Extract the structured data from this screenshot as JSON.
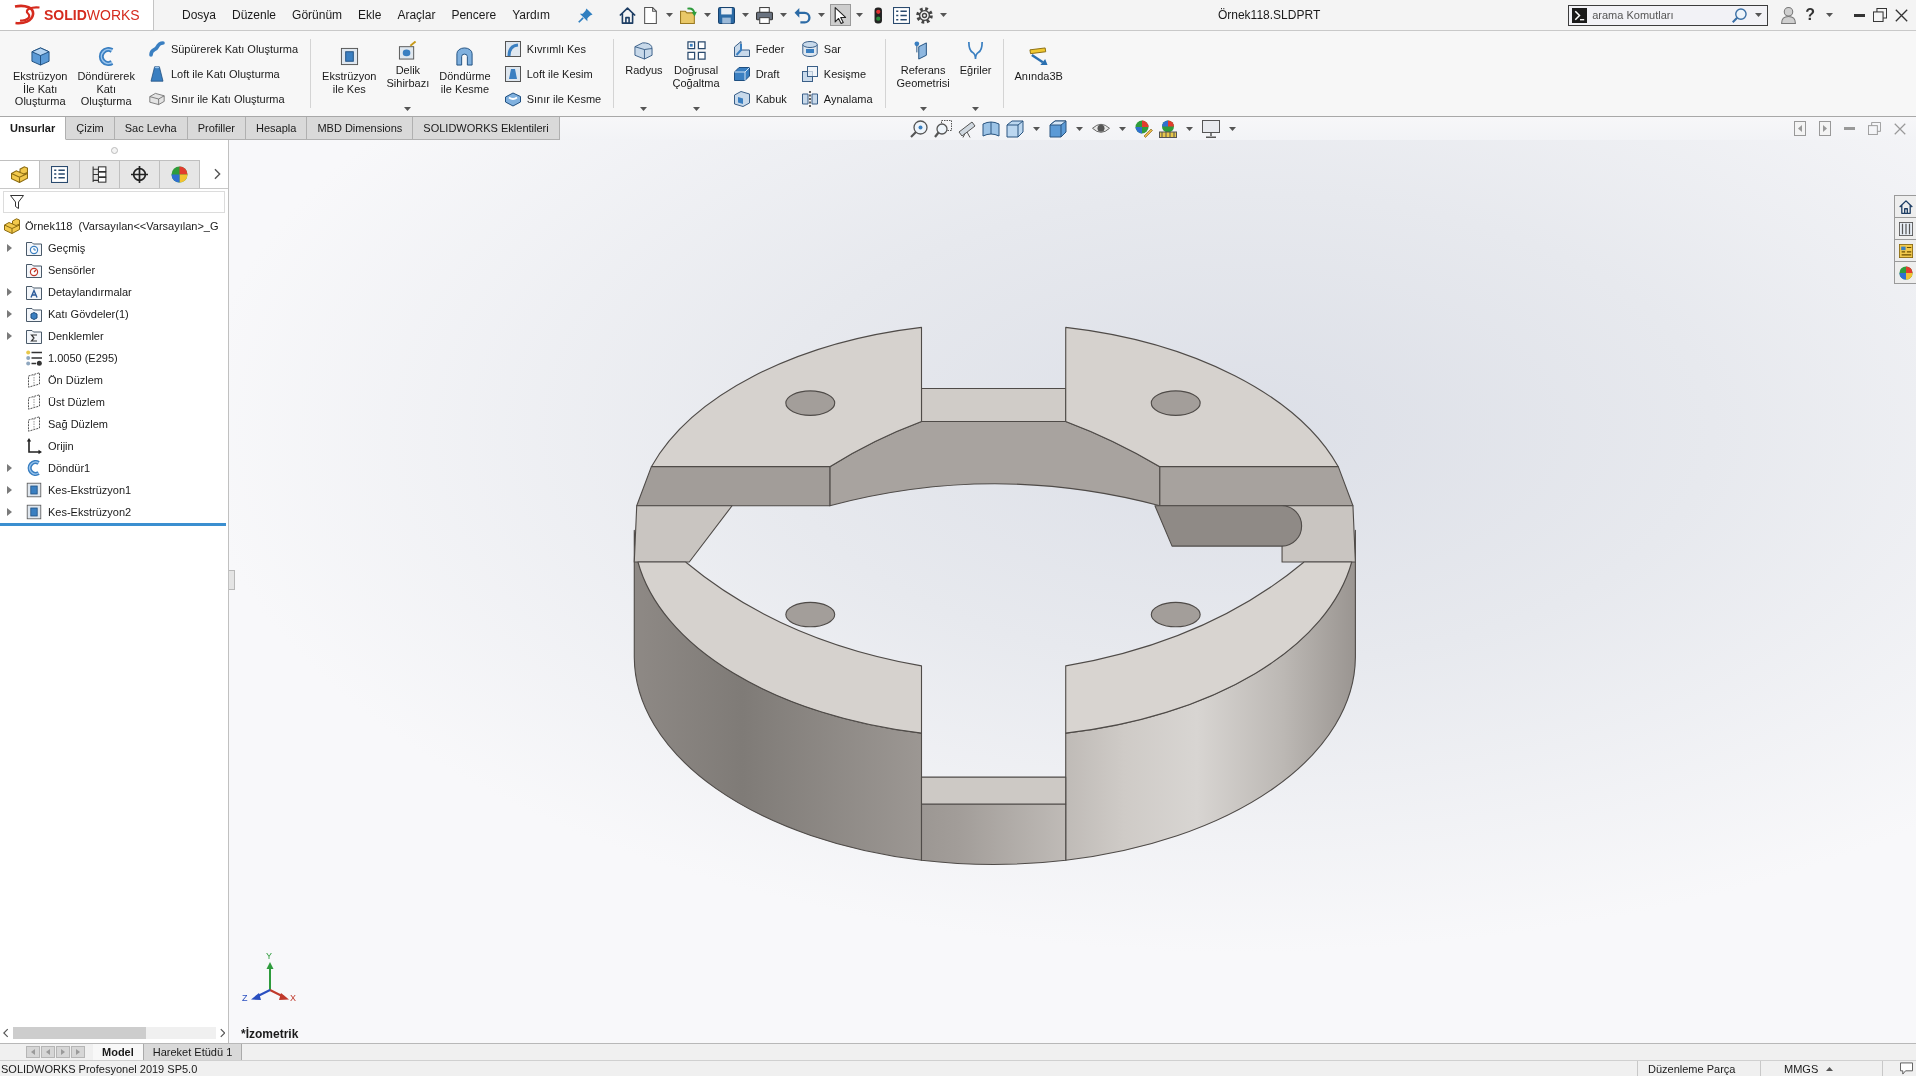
{
  "title_bar": {
    "logo": "**SOLID**WORKS",
    "menu": [
      "Dosya",
      "Düzenle",
      "Görünüm",
      "Ekle",
      "Araçlar",
      "Pencere",
      "Yardım"
    ],
    "quick_access": [
      {
        "dropdown": false,
        "selected": false
      },
      {
        "dropdown": true,
        "selected": false
      },
      {
        "dropdown": true,
        "selected": false
      },
      {
        "dropdown": true,
        "selected": false
      },
      {
        "dropdown": true,
        "selected": false
      },
      {
        "dropdown": true,
        "selected": false
      },
      {
        "dropdown": true,
        "selected": true
      },
      {
        "dropdown": false,
        "selected": false
      },
      {
        "dropdown": false,
        "selected": false
      },
      {
        "dropdown": true,
        "selected": false
      }
    ],
    "document_title": "Örnek118.SLDPRT",
    "search": {
      "placeholder": "arama Komutları"
    },
    "help": "?"
  },
  "ribbon": [
    {
      "large": [
        {
          "label": "Ekstrüzyon\nİle Katı\nOluşturma",
          "dropdown": false
        },
        {
          "label": "Döndürerek\nKatı\nOluşturma",
          "dropdown": false
        }
      ],
      "small_columns": [
        [
          "Süpürerek Katı Oluşturma",
          "Loft ile Katı Oluşturma",
          "Sınır ile Katı Oluşturma"
        ]
      ]
    },
    {
      "large": [
        {
          "label": "Ekstrüzyon\nile Kes",
          "dropdown": false
        },
        {
          "label": "Delik\nSihirbazı",
          "dropdown": true
        },
        {
          "label": "Döndürme\nile Kesme",
          "dropdown": false
        }
      ],
      "small_columns": [
        [
          "Kıvrımlı Kes",
          "Loft ile Kesim",
          "Sınır ile Kesme"
        ]
      ]
    },
    {
      "large": [
        {
          "label": "Radyus",
          "dropdown": true
        },
        {
          "label": "Doğrusal\nÇoğaltma",
          "dropdown": true
        }
      ],
      "small_columns": [
        [
          "Feder",
          "Draft",
          "Kabuk"
        ],
        [
          "Sar",
          "Kesişme",
          "Aynalama"
        ]
      ]
    },
    {
      "large": [
        {
          "label": "Referans\nGeometrisi",
          "dropdown": true
        },
        {
          "label": "Eğriler",
          "dropdown": true
        }
      ]
    },
    {
      "large": [
        {
          "label": "Anında3B",
          "dropdown": false
        }
      ]
    }
  ],
  "tabs": [
    {
      "label": "Unsurlar",
      "selected": true
    },
    {
      "label": "Çizim",
      "selected": false
    },
    {
      "label": "Sac Levha",
      "selected": false
    },
    {
      "label": "Profiller",
      "selected": false
    },
    {
      "label": "Hesapla",
      "selected": false
    },
    {
      "label": "MBD Dimensions",
      "selected": false
    },
    {
      "label": "SOLIDWORKS Eklentileri",
      "selected": false
    }
  ],
  "view_toolbar": [
    {
      "dropdown": false
    },
    {
      "dropdown": false
    },
    {
      "dropdown": false
    },
    {
      "dropdown": false
    },
    {
      "dropdown": true
    },
    {
      "dropdown": true
    },
    {
      "dropdown": true
    },
    {
      "dropdown": false
    },
    {
      "dropdown": true
    },
    {
      "dropdown": true
    }
  ],
  "feature_manager_tabs": [
    {
      "selected": true
    },
    {
      "selected": false
    },
    {
      "selected": false
    },
    {
      "selected": false
    },
    {
      "selected": false
    }
  ],
  "feature_tree": {
    "label": "Örnek118  (Varsayılan<<Varsayılan>_G",
    "children": [
      {
        "label": "Geçmiş",
        "kind": "history",
        "expanded": false
      },
      {
        "label": "Sensörler",
        "kind": "sensors"
      },
      {
        "label": "Detaylandırmalar",
        "kind": "annotations",
        "expanded": false
      },
      {
        "label": "Katı Gövdeler(1)",
        "kind": "bodies",
        "expanded": false
      },
      {
        "label": "Denklemler",
        "kind": "equations",
        "expanded": false
      },
      {
        "label": "1.0050 (E295)",
        "kind": "material"
      },
      {
        "label": "Ön Düzlem",
        "kind": "plane"
      },
      {
        "label": "Üst Düzlem",
        "kind": "plane"
      },
      {
        "label": "Sağ Düzlem",
        "kind": "plane"
      },
      {
        "label": "Orijin",
        "kind": "origin"
      },
      {
        "label": "Döndür1",
        "kind": "revolve",
        "expanded": false
      },
      {
        "label": "Kes-Ekstrüzyon1",
        "kind": "cut_extrude",
        "expanded": false
      },
      {
        "label": "Kes-Ekstrüzyon2",
        "kind": "cut_extrude",
        "expanded": false
      }
    ]
  },
  "viewport": {
    "view_name": "*İzometrik",
    "triad": {
      "x": "X",
      "y": "Y",
      "z": "Z"
    }
  },
  "bottom_tabs": [
    {
      "label": "Model",
      "selected": true
    },
    {
      "label": "Hareket Etüdü 1",
      "selected": false
    }
  ],
  "status_bar": {
    "product": "SOLIDWORKS Profesyonel 2019 SP5.0",
    "mode": "Düzenleme Parça",
    "units": "MMGS"
  }
}
